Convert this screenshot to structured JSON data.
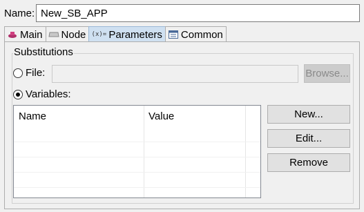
{
  "name_field": {
    "label": "Name:",
    "value": "New_SB_APP"
  },
  "tabs": [
    {
      "label": "Main",
      "icon": "main-icon",
      "active": false
    },
    {
      "label": "Node",
      "icon": "node-icon",
      "active": false
    },
    {
      "label": "Parameters",
      "icon": "parameters-icon",
      "active": true
    },
    {
      "label": "Common",
      "icon": "common-icon",
      "active": false
    }
  ],
  "substitutions": {
    "title": "Substitutions",
    "file_label": "File:",
    "file_value": "",
    "browse_label": "Browse...",
    "variables_label": "Variables:",
    "selected": "Variables"
  },
  "table": {
    "columns": [
      "Name",
      "Value"
    ],
    "rows": []
  },
  "buttons": {
    "new": "New...",
    "edit": "Edit...",
    "remove": "Remove"
  }
}
